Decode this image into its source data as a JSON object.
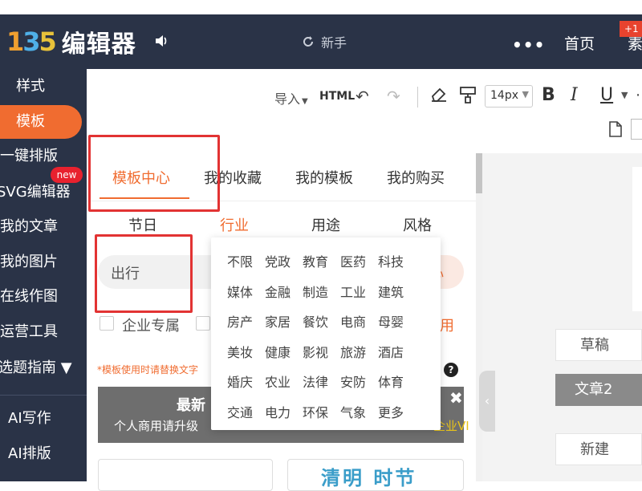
{
  "app": {
    "logo_mark": "135",
    "logo_text": "编辑器",
    "speaker_icon": "speaker-icon",
    "newbie_label": "新手",
    "more_dots": "•••",
    "home_label": "首页",
    "nav_cut_label": "素",
    "badge_text": "+1"
  },
  "sidebar": {
    "items": [
      {
        "label": "样式"
      },
      {
        "label": "模板"
      },
      {
        "label": "一键排版"
      },
      {
        "label": "SVG编辑器"
      },
      {
        "label": "我的文章"
      },
      {
        "label": "我的图片"
      },
      {
        "label": "在线作图"
      },
      {
        "label": "运营工具"
      },
      {
        "label": "选题指南 ▼"
      },
      {
        "label": "AI写作"
      },
      {
        "label": "AI排版"
      }
    ],
    "new_badge": "new"
  },
  "toolbar": {
    "import_label": "导入",
    "html_label": "HTML",
    "font_size": "14px",
    "bold": "B",
    "italic": "I",
    "underline": "U"
  },
  "panel": {
    "tabs": [
      {
        "label": "模板中心"
      },
      {
        "label": "我的收藏"
      },
      {
        "label": "我的模板"
      },
      {
        "label": "我的购买"
      }
    ],
    "subtabs": [
      {
        "label": "节日"
      },
      {
        "label": "行业"
      },
      {
        "label": "用途"
      },
      {
        "label": "风格"
      }
    ],
    "search_value": "出行",
    "search_right_fragment": "心",
    "filter_enterprise": "企业专属",
    "filter_right_fragment": "用",
    "notice": "*模板使用时请替换文字",
    "help": "?",
    "banner_title": "最新",
    "banner_sub": "个人商用请升级",
    "banner_sub_right": "企业VI",
    "banner_close": "✖",
    "card2_text": "清明 时节"
  },
  "industry_dropdown": {
    "rows": [
      [
        "不限",
        "党政",
        "教育",
        "医药",
        "科技"
      ],
      [
        "媒体",
        "金融",
        "制造",
        "工业",
        "建筑"
      ],
      [
        "房产",
        "家居",
        "餐饮",
        "电商",
        "母婴"
      ],
      [
        "美妆",
        "健康",
        "影视",
        "旅游",
        "酒店"
      ],
      [
        "婚庆",
        "农业",
        "法律",
        "安防",
        "体育"
      ],
      [
        "交通",
        "电力",
        "环保",
        "气象",
        "更多"
      ]
    ]
  },
  "right_panel": {
    "draft_label": "草稿",
    "article2_label": "文章2",
    "new_label": "新建",
    "collapse": "‹"
  },
  "colors": {
    "nav_bg": "#2a3347",
    "accent": "#f06c30",
    "highlight_red": "#e23333"
  }
}
